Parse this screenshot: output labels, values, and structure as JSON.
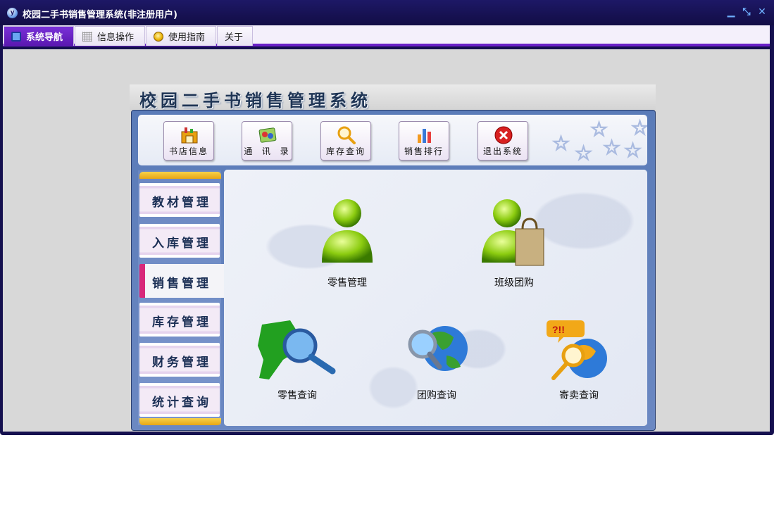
{
  "window": {
    "title": "校园二手书销售管理系统(非注册用户)",
    "controls": {
      "minimize": "▁",
      "restore": "⤡",
      "close": "✕"
    }
  },
  "menu": {
    "tabs": [
      {
        "label": "系统导航",
        "icon": "monitor-icon",
        "active": true
      },
      {
        "label": "信息操作",
        "icon": "grid-icon",
        "active": false
      },
      {
        "label": "使用指南",
        "icon": "coin-icon",
        "active": false
      },
      {
        "label": "关于",
        "icon": "",
        "active": false
      }
    ]
  },
  "app": {
    "title": "校园二手书销售管理系统"
  },
  "toolbar": {
    "buttons": [
      {
        "label": "书店信息",
        "icon": "bookstore-icon"
      },
      {
        "label": "通  讯  录",
        "icon": "address-book-icon"
      },
      {
        "label": "库存查询",
        "icon": "magnifier-icon"
      },
      {
        "label": "销售排行",
        "icon": "bar-chart-icon"
      },
      {
        "label": "退出系统",
        "icon": "exit-icon"
      }
    ]
  },
  "sidebar": {
    "items": [
      {
        "label": "教材管理",
        "active": false
      },
      {
        "label": "入库管理",
        "active": false
      },
      {
        "label": "销售管理",
        "active": true
      },
      {
        "label": "库存管理",
        "active": false
      },
      {
        "label": "财务管理",
        "active": false
      },
      {
        "label": "统计查询",
        "active": false
      }
    ]
  },
  "functions": {
    "items": [
      {
        "label": "零售管理",
        "icon": "retail-user-icon"
      },
      {
        "label": "班级团购",
        "icon": "group-buy-user-icon"
      },
      {
        "label": "零售查询",
        "icon": "retail-search-icon"
      },
      {
        "label": "团购查询",
        "icon": "group-search-icon"
      },
      {
        "label": "寄卖查询",
        "icon": "consignment-search-icon"
      }
    ]
  },
  "colors": {
    "title_bar": "#15104f",
    "menu_accent": "#6a20c8",
    "panel_blue": "#5a7bb8",
    "sidebar_active_marker": "#d8287a"
  }
}
